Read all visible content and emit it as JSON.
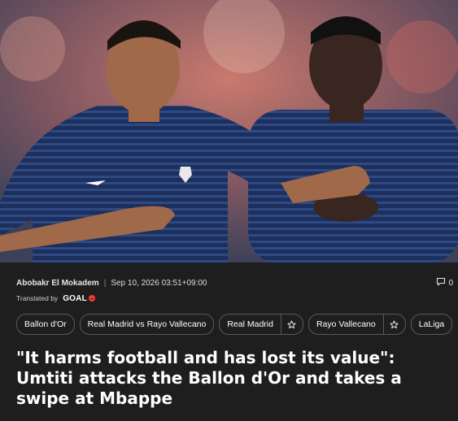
{
  "hero": {
    "icon": "photo-players-training"
  },
  "meta": {
    "author": "Abobakr El Mokadem",
    "separator": "|",
    "date": "Sep 10, 2026 03:51+09:00",
    "comment_count": "0",
    "comment_icon": "speech-bubble-icon"
  },
  "translated": {
    "label": "Translated by",
    "brand": "GOAL"
  },
  "tags": [
    {
      "label": "Ballon d'Or",
      "star": false
    },
    {
      "label": "Real Madrid vs Rayo Vallecano",
      "star": false
    },
    {
      "label": "Real Madrid",
      "star": true
    },
    {
      "label": "Rayo Vallecano",
      "star": true
    },
    {
      "label": "LaLiga",
      "star": false
    }
  ],
  "headline": "\"It harms football and has lost its value\": Umtiti attacks the Ballon d'Or and takes a swipe at Mbappe",
  "colors": {
    "background": "#1e1e1e",
    "jersey": "#1d2f5c",
    "brand_accent": "#ff3a2f"
  }
}
